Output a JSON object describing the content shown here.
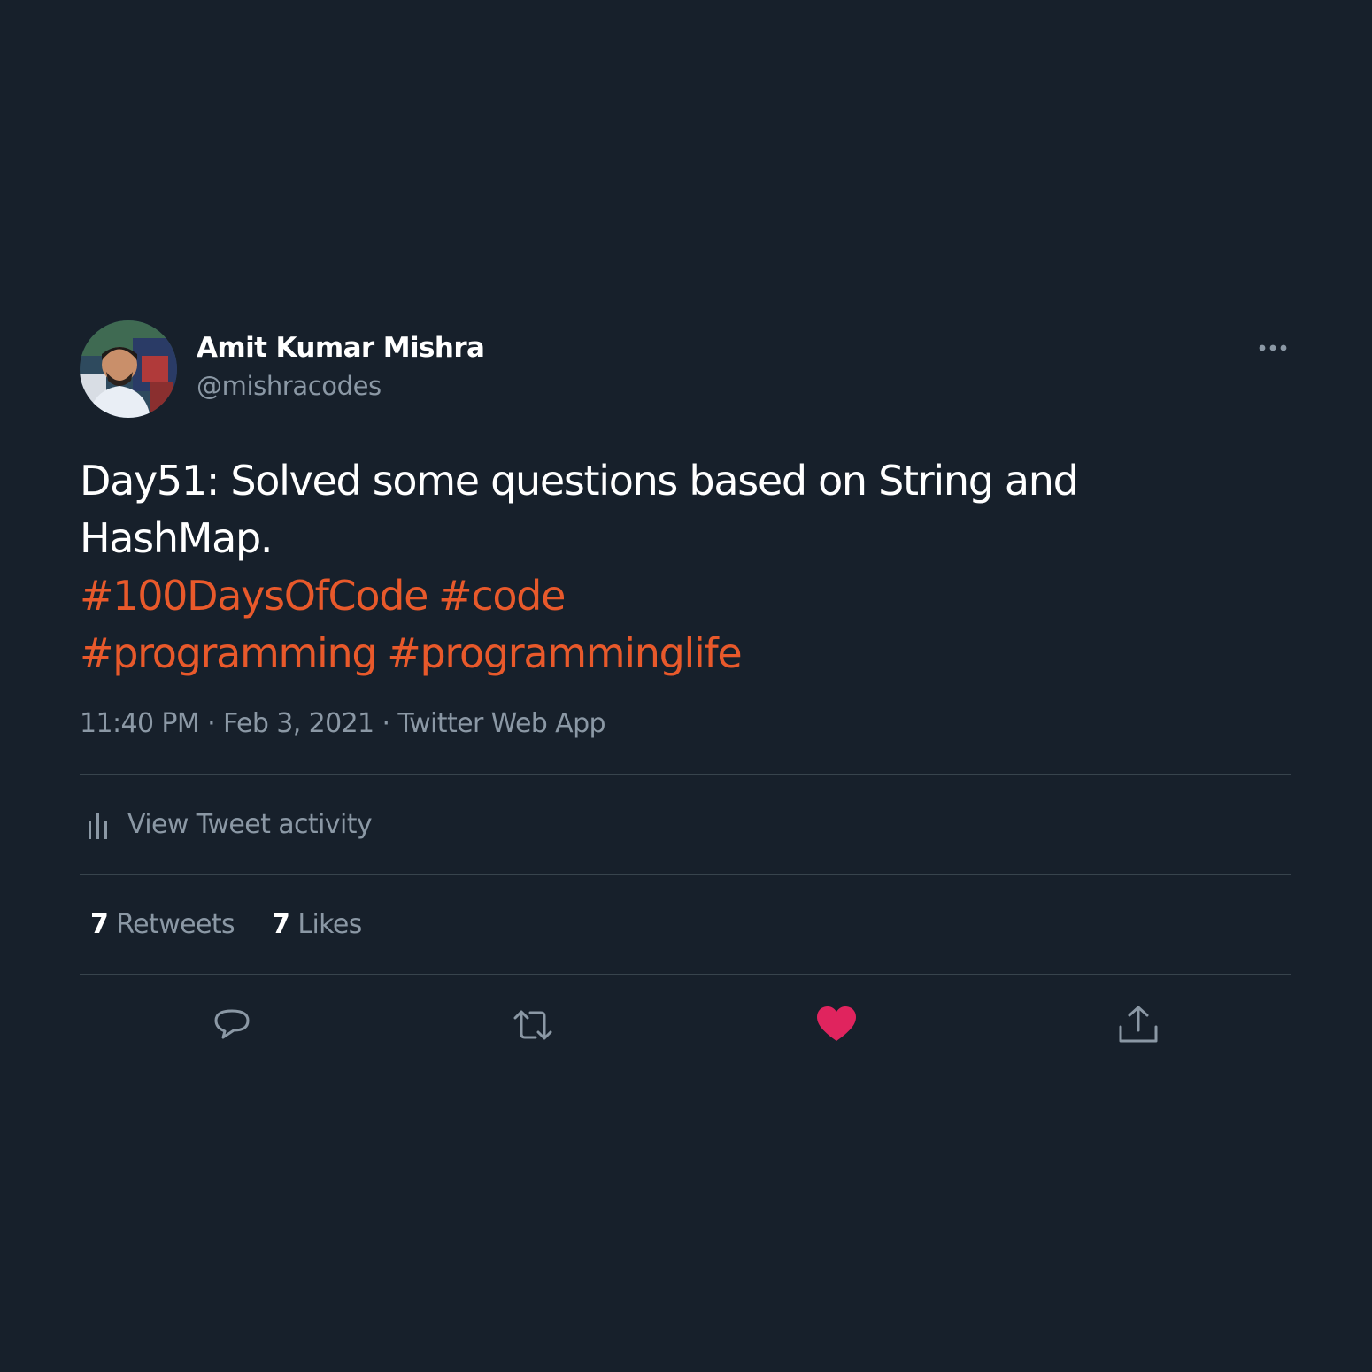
{
  "colors": {
    "background": "#17202b",
    "text": "#ffffff",
    "muted": "#8b98a5",
    "hashtag": "#e8592b",
    "like": "#e0245e",
    "divider": "#38444d"
  },
  "author": {
    "display_name": "Amit Kumar Mishra",
    "handle": "@mishracodes",
    "avatar_icon": "profile-photo"
  },
  "header": {
    "more_icon": "more-options-icon"
  },
  "tweet": {
    "text": "Day51: Solved some questions based on String and HashMap.",
    "hashtags": [
      "#100DaysOfCode",
      "#code",
      "#programming",
      "#programminglife"
    ]
  },
  "meta": {
    "time": "11:40 PM",
    "separator": "·",
    "date": "Feb 3, 2021",
    "source": "Twitter Web App"
  },
  "activity": {
    "label": "View Tweet activity",
    "icon": "activity-bars-icon"
  },
  "stats": {
    "retweets_count": "7",
    "retweets_label": "Retweets",
    "likes_count": "7",
    "likes_label": "Likes"
  },
  "actions": [
    {
      "name": "reply",
      "icon": "reply-icon",
      "active": false
    },
    {
      "name": "retweet",
      "icon": "retweet-icon",
      "active": false
    },
    {
      "name": "like",
      "icon": "heart-icon",
      "active": true
    },
    {
      "name": "share",
      "icon": "share-icon",
      "active": false
    }
  ]
}
